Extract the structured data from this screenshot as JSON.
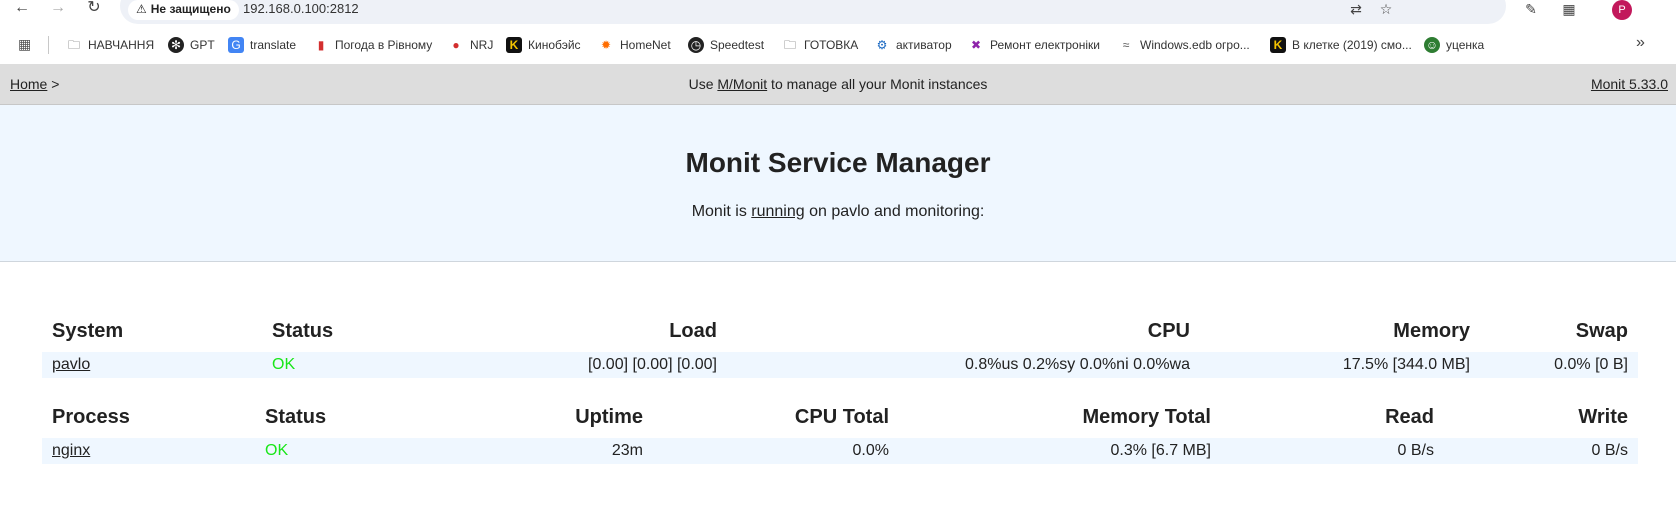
{
  "browser": {
    "security_label": "Не защищено",
    "url": "192.168.0.100:2812",
    "profile_initial": "P",
    "bookmarks": [
      {
        "label": "НАВЧАННЯ",
        "icon": "folder-icon"
      },
      {
        "label": "GPT",
        "icon": "openai-icon"
      },
      {
        "label": "translate",
        "icon": "google-translate-icon"
      },
      {
        "label": "Погода в Рівному",
        "icon": "thermometer-icon"
      },
      {
        "label": "NRJ",
        "icon": "nrj-icon"
      },
      {
        "label": "Кинобэйс",
        "icon": "kinobase-icon"
      },
      {
        "label": "HomeNet",
        "icon": "sun-icon"
      },
      {
        "label": "Speedtest",
        "icon": "speedtest-icon"
      },
      {
        "label": "ГОТОВКА",
        "icon": "folder-icon"
      },
      {
        "label": "активатор",
        "icon": "gear-icon"
      },
      {
        "label": "Ремонт електроніки",
        "icon": "tools-icon"
      },
      {
        "label": "Windows.edb огро...",
        "icon": "waveform-icon"
      },
      {
        "label": "В клетке (2019) смо...",
        "icon": "kinobase-icon"
      },
      {
        "label": "уценка",
        "icon": "face-icon"
      }
    ],
    "colors": {
      "omnibox": "#eef1f7",
      "avatar": "#c2185b"
    }
  },
  "header": {
    "home_link": "Home",
    "breadcrumb_sep": " >",
    "note_prefix": "Use ",
    "note_link": "M/Monit",
    "note_suffix": " to manage all your Monit instances",
    "version": "Monit 5.33.0"
  },
  "hero": {
    "title": "Monit Service Manager",
    "subtitle_prefix": "Monit is ",
    "subtitle_link": "running",
    "subtitle_suffix": " on pavlo and monitoring:"
  },
  "system_table": {
    "headers": [
      "System",
      "Status",
      "Load",
      "CPU",
      "Memory",
      "Swap"
    ],
    "row": {
      "name": "pavlo",
      "status": "OK",
      "load": "[0.00] [0.00] [0.00]",
      "cpu": "0.8%us 0.2%sy 0.0%ni 0.0%wa",
      "memory": "17.5% [344.0 MB]",
      "swap": "0.0% [0 B]"
    }
  },
  "process_table": {
    "headers": [
      "Process",
      "Status",
      "Uptime",
      "CPU Total",
      "Memory Total",
      "Read",
      "Write"
    ],
    "row": {
      "name": "nginx",
      "status": "OK",
      "uptime": "23m",
      "cpu_total": "0.0%",
      "memory_total": "0.3% [6.7 MB]",
      "read": "0 B/s",
      "write": "0 B/s"
    }
  },
  "colors": {
    "header_bg": "#dddddd",
    "hero_bg": "#eff7ff",
    "row_bg": "#eff7ff",
    "status_ok": "#19e619"
  }
}
